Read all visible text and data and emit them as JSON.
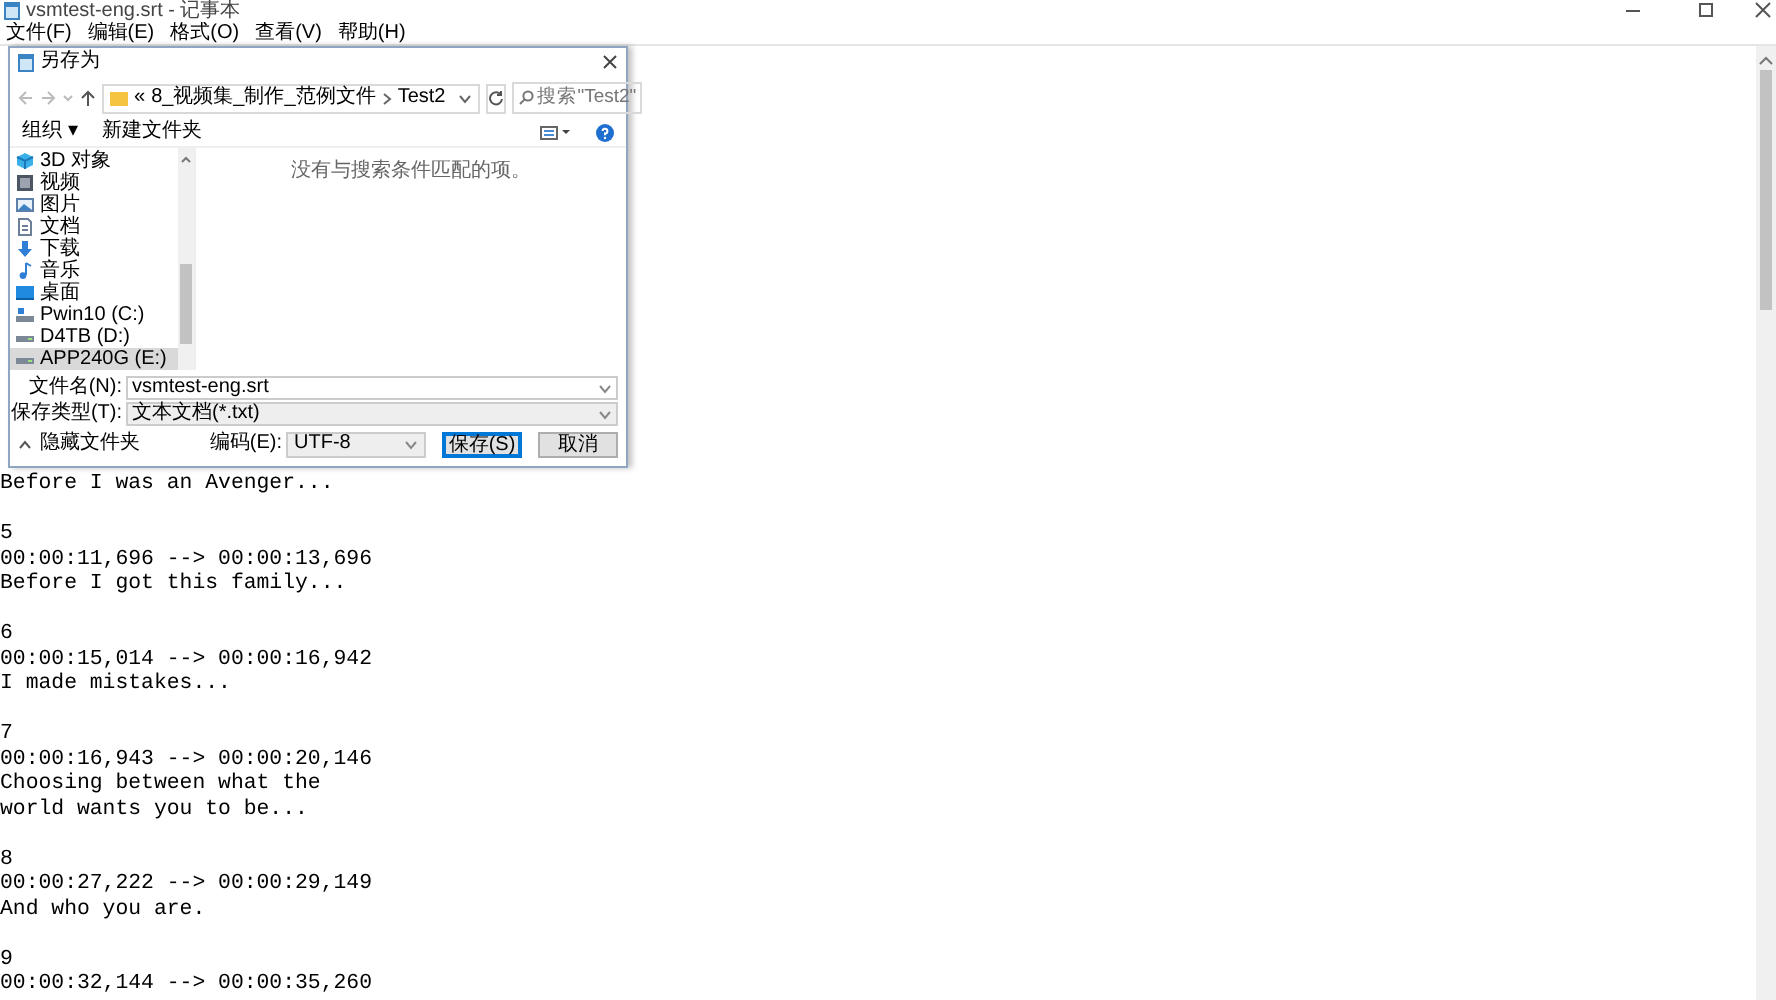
{
  "window": {
    "title": "vsmtest-eng.srt - 记事本"
  },
  "menu": [
    {
      "label": "文件(F)"
    },
    {
      "label": "编辑(E)"
    },
    {
      "label": "格式(O)"
    },
    {
      "label": "查看(V)"
    },
    {
      "label": "帮助(H)"
    }
  ],
  "editor": {
    "blocks": [
      {
        "text": [
          "Before I was an Avenger..."
        ]
      },
      {
        "index": "5",
        "time": "00:00:11,696 --> 00:00:13,696",
        "text": [
          "Before I got this family..."
        ]
      },
      {
        "index": "6",
        "time": "00:00:15,014 --> 00:00:16,942",
        "text": [
          "I made mistakes..."
        ]
      },
      {
        "index": "7",
        "time": "00:00:16,943 --> 00:00:20,146",
        "text": [
          "Choosing between what the",
          "world wants you to be..."
        ]
      },
      {
        "index": "8",
        "time": "00:00:27,222 --> 00:00:29,149",
        "text": [
          "And who you are."
        ]
      },
      {
        "index": "9",
        "time": "00:00:32,144 --> 00:00:35,260"
      }
    ]
  },
  "dialog": {
    "title": "另存为",
    "address": {
      "overflow": "«",
      "crumbs": [
        "8_视频集_制作_范例文件",
        "Test2"
      ]
    },
    "search": {
      "placeholder": "搜索\"Test2\""
    },
    "toolbar": {
      "organize": "组织 ▾",
      "new_folder": "新建文件夹"
    },
    "sidebar": {
      "items": [
        {
          "label": "3D 对象",
          "kind": "objects",
          "selected": false
        },
        {
          "label": "视频",
          "kind": "video",
          "selected": false
        },
        {
          "label": "图片",
          "kind": "pictures",
          "selected": false
        },
        {
          "label": "文档",
          "kind": "documents",
          "selected": false
        },
        {
          "label": "下载",
          "kind": "downloads",
          "selected": false
        },
        {
          "label": "音乐",
          "kind": "music",
          "selected": false
        },
        {
          "label": "桌面",
          "kind": "desktop",
          "selected": false
        },
        {
          "label": "Pwin10 (C:)",
          "kind": "system-drive",
          "selected": false
        },
        {
          "label": "D4TB (D:)",
          "kind": "drive",
          "selected": false
        },
        {
          "label": "APP240G (E:)",
          "kind": "drive",
          "selected": true
        }
      ]
    },
    "empty_message": "没有与搜索条件匹配的项。",
    "file_name": {
      "label": "文件名(N):",
      "value": "vsmtest-eng.srt"
    },
    "file_type": {
      "label": "保存类型(T):",
      "value": "文本文档(*.txt)"
    },
    "hide_folders": "隐藏文件夹",
    "encoding": {
      "label": "编码(E):",
      "value": "UTF-8"
    },
    "buttons": [
      {
        "label": "保存(S)",
        "primary": true
      },
      {
        "label": "取消",
        "primary": false
      }
    ]
  }
}
